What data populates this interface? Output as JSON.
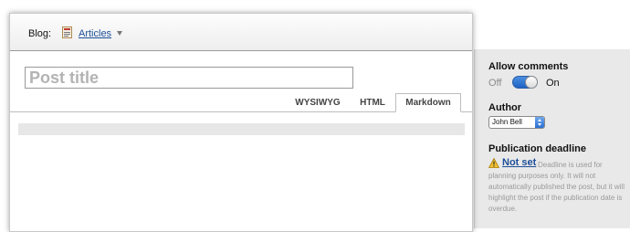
{
  "header": {
    "blog_label": "Blog:",
    "blog_name": "Articles"
  },
  "editor": {
    "title_placeholder": "Post title",
    "tabs": [
      {
        "label": "WYSIWYG"
      },
      {
        "label": "HTML"
      },
      {
        "label": "Markdown",
        "active": true
      }
    ]
  },
  "sidebar": {
    "comments": {
      "title": "Allow comments",
      "off_label": "Off",
      "on_label": "On",
      "enabled": true
    },
    "author": {
      "title": "Author",
      "selected": "John Bell"
    },
    "deadline": {
      "title": "Publication deadline",
      "link_label": "Not set",
      "note": "Deadline is used for planning purposes only. It will not automatically published the post, but it will highlight the post if the publication date is overdue."
    }
  },
  "colors": {
    "link": "#1d4f99",
    "toggle_on": "#2f78d6",
    "panel_bg": "#e9e9e9"
  },
  "icons": {
    "blog_icon": "document-icon",
    "deadline_icon": "warning-icon"
  }
}
